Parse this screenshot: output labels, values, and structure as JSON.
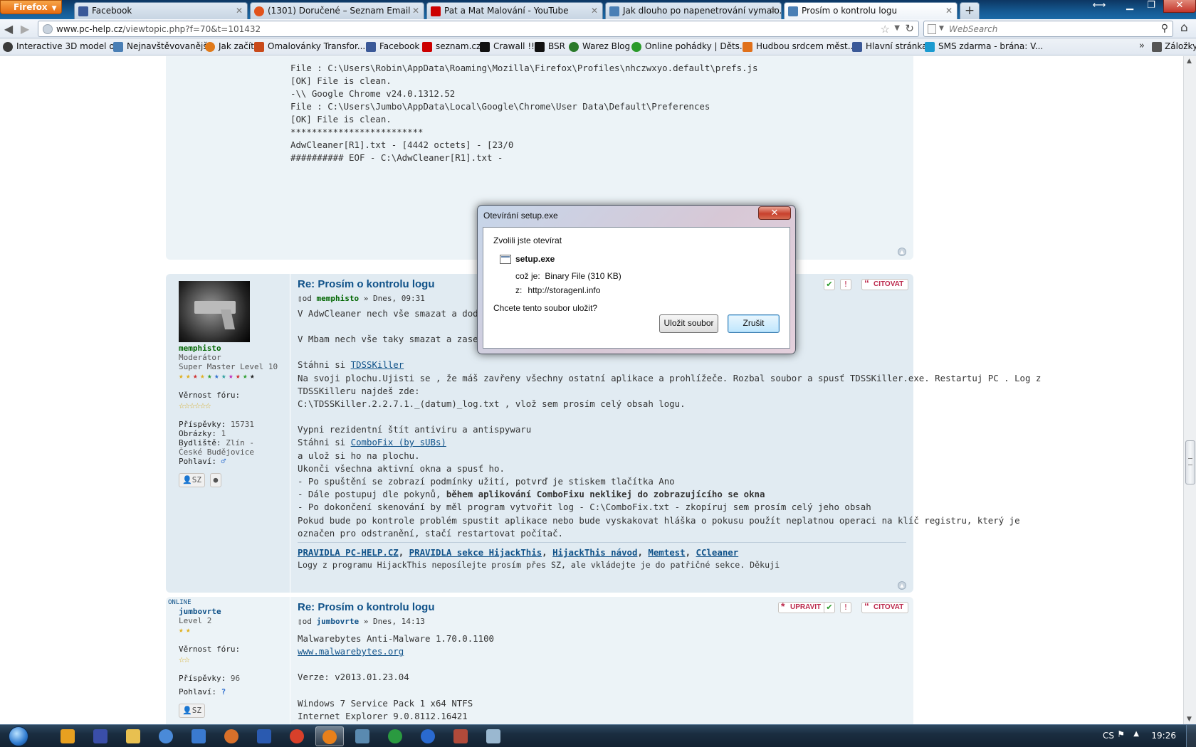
{
  "browser": {
    "firefox_button": "Firefox",
    "tabs": [
      {
        "label": "Facebook",
        "color": "#3b5998"
      },
      {
        "label": "(1301) Doručené – Seznam Email",
        "color": "#e2531c"
      },
      {
        "label": "Pat a Mat Malování - YouTube",
        "color": "#cc0000"
      },
      {
        "label": "Jak dlouho po napenetrování vymalo...",
        "color": "#4a7fb5"
      },
      {
        "label": "Prosím o kontrolu logu",
        "color": "#4a7fb5"
      }
    ],
    "newtab_label": "+",
    "url_host": "www.pc-help.cz",
    "url_path": "/viewtopic.php?f=70&t=101432",
    "search_placeholder": "WebSearch",
    "bookmarks": [
      {
        "label": "Interactive 3D model o...",
        "color": "#3a3a3a"
      },
      {
        "label": "Nejnavštěvovanější",
        "color": "#4a7fb5"
      },
      {
        "label": "Jak začít",
        "color": "#e07a1a"
      },
      {
        "label": "Omalovánky Transfor...",
        "color": "#c94a1a"
      },
      {
        "label": "Facebook",
        "color": "#3b5998"
      },
      {
        "label": "seznam.cz",
        "color": "#cc0000"
      },
      {
        "label": "Crawall !!!",
        "color": "#111111"
      },
      {
        "label": "BSR",
        "color": "#111111"
      },
      {
        "label": "Warez Blog",
        "color": "#2a7a2a"
      },
      {
        "label": "Online pohádky | Děts...",
        "color": "#2a9a2a"
      },
      {
        "label": "Hudbou srdcem měst...",
        "color": "#e0701a"
      },
      {
        "label": "Hlavní stránka",
        "color": "#3b5998"
      },
      {
        "label": "SMS zdarma - brána: V...",
        "color": "#1a9ad0"
      }
    ],
    "bookmarks_chevron": "»",
    "bookmarks_menu": "Záložky"
  },
  "post1": {
    "lines": [
      "File : C:\\Users\\Robin\\AppData\\Roaming\\Mozilla\\Firefox\\Profiles\\nhczwxyo.default\\prefs.js",
      "",
      "[OK] File is clean.",
      "",
      "-\\\\ Google Chrome v24.0.1312.52",
      "",
      "File : C:\\Users\\Jumbo\\AppData\\Local\\Google\\Chrome\\User Data\\Default\\Preferences",
      "",
      "[OK] File is clean.",
      "",
      "*************************",
      "",
      "AdwCleaner[R1].txt - [4442 octets] - [23/0",
      "",
      "########## EOF - C:\\AdwCleaner[R1].txt -"
    ]
  },
  "post2": {
    "title": "Re: Prosím o kontrolu logu",
    "meta_prefix": "od",
    "author": "memphisto",
    "meta_suffix": "» Dnes, 09:31",
    "quote_label": "CITOVAT",
    "profile": {
      "username": "memphisto",
      "role": "Moderátor",
      "rank": "Super Master Level 10",
      "loyalty_label": "Věrnost fóru:",
      "posts_label": "Příspěvky:",
      "posts_value": "15731",
      "images_label": "Obrázky:",
      "images_value": "1",
      "residence_label": "Bydliště:",
      "residence_value": "Zlín - České Budějovice",
      "gender_label": "Pohlaví:",
      "pm_label": "SZ"
    },
    "body": {
      "l1": "V AdwCleaner nech vše smazat a dodej log",
      "l2": "V Mbam nech vše taky smazat a zase log",
      "l3_prefix": "Stáhni si ",
      "l3_link": "TDSSKiller",
      "l4": "Na svoji plochu.Ujisti se , že máš zavřeny všechny ostatní aplikace a prohlížeče. Rozbal soubor a spusť TDSSKiller.exe. Restartuj PC . Log z",
      "l5": "TDSSKilleru najdeš zde:",
      "l6": "C:\\TDSSKiller.2.2.7.1._(datum)_log.txt , vlož sem prosím celý obsah logu.",
      "l7": "Vypni rezidentní štít antiviru a antispywaru",
      "l8_prefix": "Stáhni si ",
      "l8_link": "ComboFix (by sUBs)",
      "l9": "a ulož si ho na plochu.",
      "l10": "Ukonči všechna aktivní okna a spusť ho.",
      "l11": "- Po spuštění se zobrazí podmínky užití, potvrď je stiskem tlačítka Ano",
      "l12_prefix": "- Dále postupuj dle pokynů, ",
      "l12_bold": "během aplikování ComboFixu neklikej do zobrazujícího se okna",
      "l13": "- Po dokončení skenování by měl program vytvořit log - C:\\ComboFix.txt - zkopíruj sem prosím celý jeho obsah",
      "l14": "Pokud bude po kontrole problém spustit aplikace nebo bude vyskakovat hláška o pokusu použít neplatnou operaci na klíč registru, který je",
      "l15": "označen pro odstranění, stačí restartovat počítač."
    },
    "signature": {
      "links": [
        "PRAVIDLA PC-HELP.CZ",
        "PRAVIDLA sekce HijackThis",
        "HijackThis návod",
        "Memtest",
        "CCleaner"
      ],
      "note": "Logy z programu HijackThis neposílejte prosím přes SZ, ale vkládejte je do patřičné sekce. Děkuji"
    }
  },
  "post3": {
    "online_badge": "ONLINE",
    "title": "Re: Prosím o kontrolu logu",
    "meta_prefix": "od",
    "author": "jumbovrte",
    "meta_suffix": "» Dnes, 14:13",
    "edit_label": "UPRAVIT",
    "quote_label": "CITOVAT",
    "profile": {
      "username": "jumbovrte",
      "rank": "Level 2",
      "loyalty_label": "Věrnost fóru:",
      "posts_label": "Příspěvky:",
      "posts_value": "96",
      "gender_label": "Pohlaví:",
      "gender_value": "?",
      "pm_label": "SZ"
    },
    "body": {
      "l1": "Malwarebytes Anti-Malware 1.70.0.1100",
      "l2_link": "www.malwarebytes.org",
      "l3": "Verze: v2013.01.23.04",
      "l4": "Windows 7 Service Pack 1 x64 NTFS",
      "l5": "Internet Explorer 9.0.8112.16421"
    }
  },
  "dialog": {
    "title": "Otevírání setup.exe",
    "close_label": "✕",
    "intro": "Zvolili jste otevírat",
    "filename": "setup.exe",
    "type_label": "což je:",
    "type_value": "Binary File (310 KB)",
    "from_label": "z:",
    "from_value": "http://storagenl.info",
    "question": "Chcete tento soubor uložit?",
    "save_label": "Uložit soubor",
    "cancel_label": "Zrušit"
  },
  "taskbar": {
    "apps": [
      {
        "name": "media-player",
        "color": "#e8a020"
      },
      {
        "name": "floppy-app",
        "color": "#3a4ea8"
      },
      {
        "name": "explorer",
        "color": "#e8c050"
      },
      {
        "name": "search-app",
        "color": "#4a8ad8"
      },
      {
        "name": "network-app",
        "color": "#3a7ad0"
      },
      {
        "name": "gear-app",
        "color": "#d8702a"
      },
      {
        "name": "word",
        "color": "#2a5ab0"
      },
      {
        "name": "chrome",
        "color": "#d8402a"
      },
      {
        "name": "firefox",
        "color": "#e8801a"
      },
      {
        "name": "ship-app",
        "color": "#5a8ab0"
      },
      {
        "name": "utorrent",
        "color": "#2a9a40"
      },
      {
        "name": "bolt-app",
        "color": "#2a6ad0"
      },
      {
        "name": "game-app",
        "color": "#b04a3a"
      },
      {
        "name": "window-app",
        "color": "#9ab8d0"
      }
    ],
    "language": "CS",
    "time": "19:26"
  }
}
